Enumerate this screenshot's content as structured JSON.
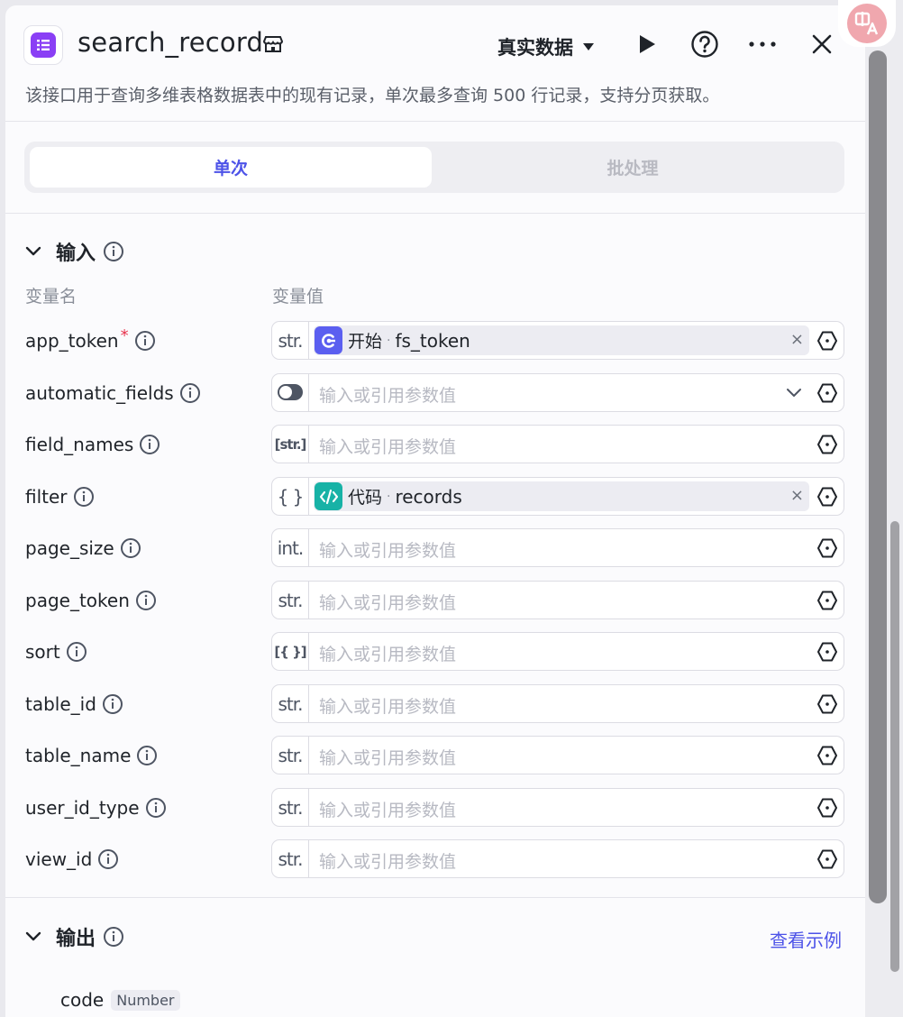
{
  "header": {
    "title": "search_record",
    "mode_label": "真实数据",
    "description": "该接口用于查询多维表格数据表中的现有记录，单次最多查询 500 行记录，支持分页获取。"
  },
  "tabs": [
    {
      "label": "单次",
      "active": true
    },
    {
      "label": "批处理",
      "active": false
    }
  ],
  "input_section": {
    "title": "输入",
    "col_name": "变量名",
    "col_value": "变量值",
    "placeholder": "输入或引用参数值",
    "params": [
      {
        "name": "app_token",
        "required": true,
        "type": "str.",
        "value_source": "开始",
        "value_var": "fs_token"
      },
      {
        "name": "automatic_fields",
        "required": false,
        "type": "toggle"
      },
      {
        "name": "field_names",
        "required": false,
        "type": "[str.]"
      },
      {
        "name": "filter",
        "required": false,
        "type": "{ }",
        "value_source": "代码",
        "value_var": "records"
      },
      {
        "name": "page_size",
        "required": false,
        "type": "int."
      },
      {
        "name": "page_token",
        "required": false,
        "type": "str."
      },
      {
        "name": "sort",
        "required": false,
        "type": "[{ }]"
      },
      {
        "name": "table_id",
        "required": false,
        "type": "str."
      },
      {
        "name": "table_name",
        "required": false,
        "type": "str."
      },
      {
        "name": "user_id_type",
        "required": false,
        "type": "str."
      },
      {
        "name": "view_id",
        "required": false,
        "type": "str."
      }
    ]
  },
  "output_section": {
    "title": "输出",
    "see_example": "查看示例",
    "fields": [
      {
        "name": "code",
        "type": "Number"
      }
    ]
  },
  "colors": {
    "accent": "#4d53e8",
    "app_icon": "#8a3ff5",
    "start_node": "#5b5ff0",
    "code_node": "#17b2a6"
  }
}
